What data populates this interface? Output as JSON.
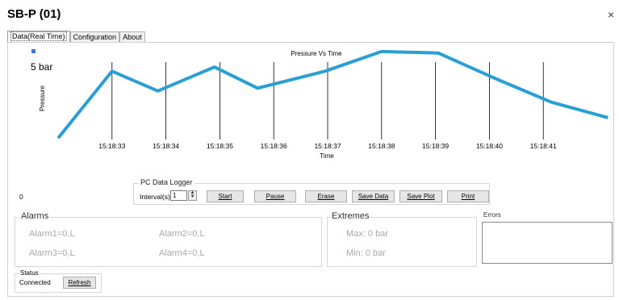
{
  "window": {
    "title": "SB-P (01)",
    "close_glyph": "×"
  },
  "tabs": [
    {
      "label": "Data(Real Time)",
      "active": true
    },
    {
      "label": "Configuration",
      "active": false
    },
    {
      "label": "About",
      "active": false
    }
  ],
  "chart_data": {
    "type": "line",
    "title": "Pressure Vs Time",
    "xlabel": "Time",
    "ylabel": "Pressure",
    "y_tick_label": "5 bar",
    "y_tick_value": 5,
    "ylim": [
      0,
      5.5
    ],
    "x_tick_labels": [
      "15:18:33",
      "15:18:34",
      "15:18:35",
      "15:18:36",
      "15:18:37",
      "15:18:38",
      "15:18:39",
      "15:18:40",
      "15:18:41"
    ],
    "grid": "vertical",
    "legend_marker_color": "#3c78d8",
    "series": [
      {
        "color": "#2a9fd6",
        "x": [
          32.0,
          33.0,
          33.85,
          34.9,
          35.7,
          36.95,
          38.0,
          39.05,
          40.1,
          41.15,
          42.2
        ],
        "y": [
          0.1,
          4.85,
          3.45,
          5.15,
          3.65,
          4.85,
          6.25,
          6.15,
          4.35,
          2.65,
          1.55
        ]
      }
    ]
  },
  "counter": {
    "value": "0"
  },
  "logger": {
    "title": "PC Data Logger",
    "interval_label": "Interval(s):",
    "interval_value": "1",
    "buttons": [
      "Start",
      "Pause",
      "Erase",
      "Save Data",
      "Save Plot",
      "Print"
    ]
  },
  "alarms": {
    "title": "Alarms",
    "items": [
      "Alarm1=0,L",
      "Alarm2=0,L",
      "Alarm3=0,L",
      "Alarm4=0,L"
    ]
  },
  "extremes": {
    "title": "Extremes",
    "max": "Max: 0 bar",
    "min": "Min: 0 bar"
  },
  "errors": {
    "title": "Errors"
  },
  "status": {
    "title": "Status",
    "value": "Connected",
    "refresh_label": "Refresh"
  }
}
